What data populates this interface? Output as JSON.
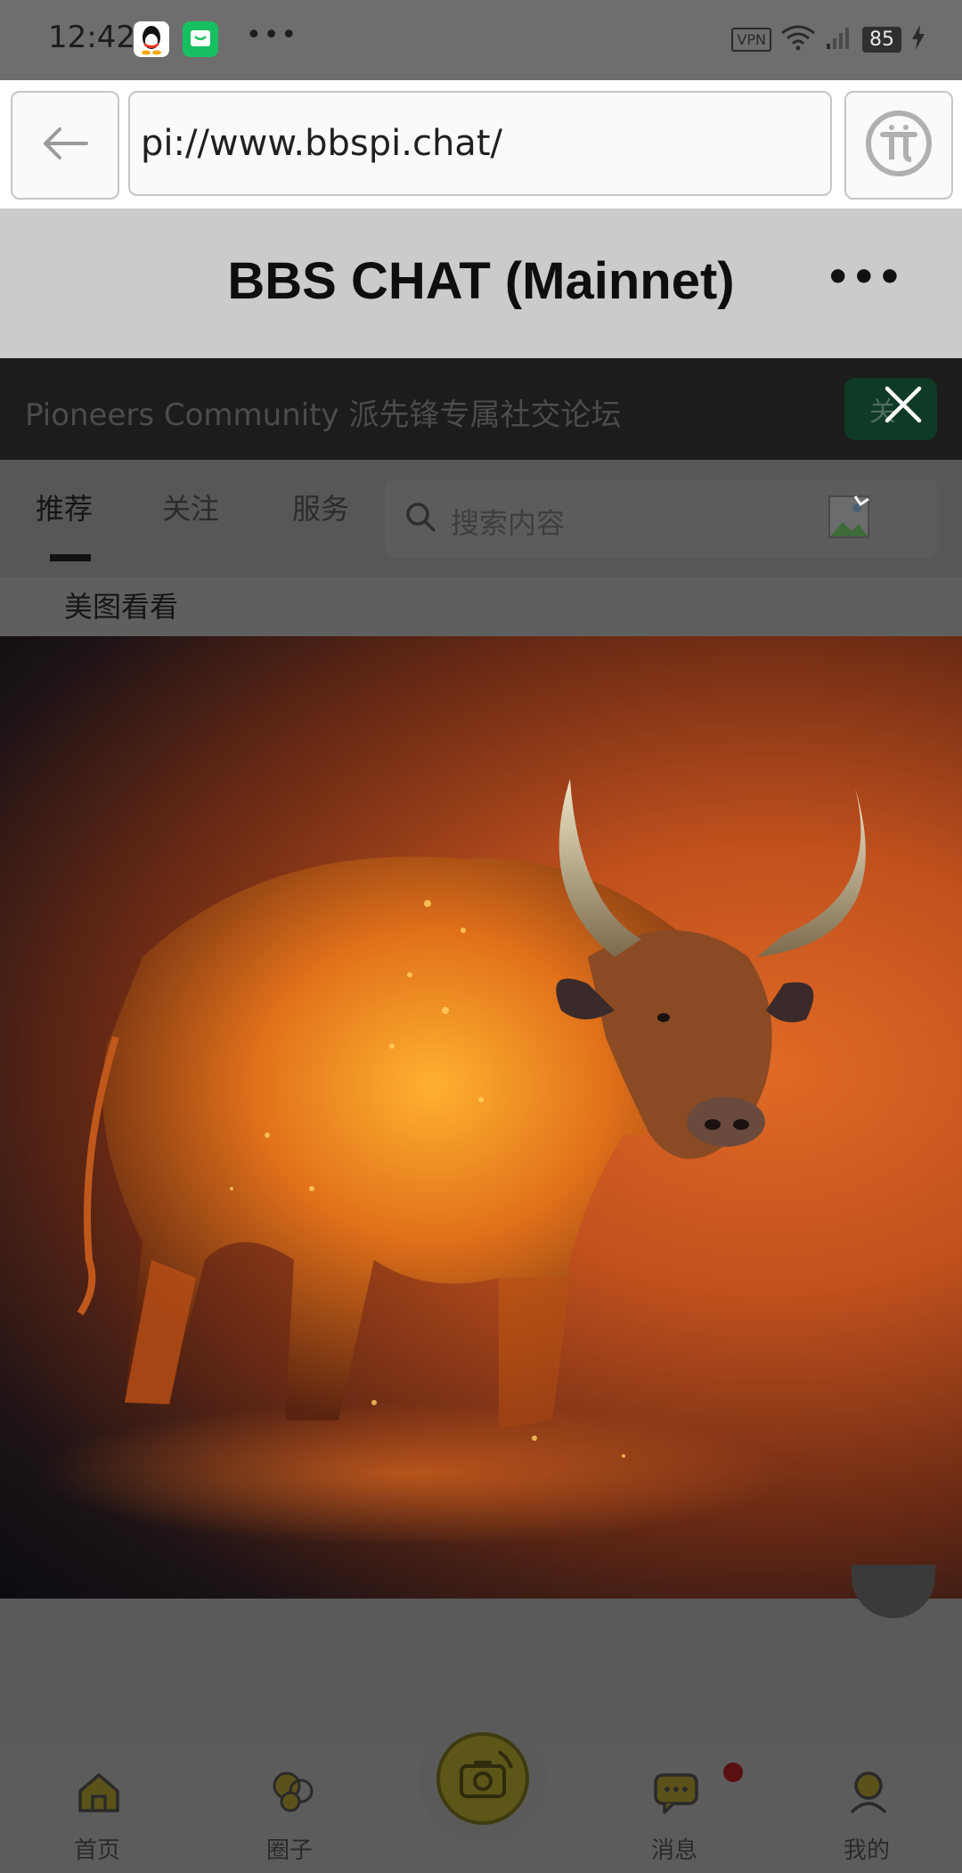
{
  "status_bar": {
    "time": "12:42",
    "dots": "•••",
    "vpn": "VPN",
    "battery": "85"
  },
  "browser": {
    "url": "pi://www.bbspi.chat/"
  },
  "app": {
    "title": "BBS CHAT (Mainnet)",
    "more": "•••"
  },
  "banner": {
    "text": "Pioneers Community 派先锋专属社交论坛",
    "button_label": "关"
  },
  "tabs": [
    {
      "label": "推荐"
    },
    {
      "label": "关注"
    },
    {
      "label": "服务"
    }
  ],
  "search": {
    "placeholder": "搜索内容"
  },
  "subtab": {
    "label": "美图看看"
  },
  "bottom_nav": [
    {
      "label": "首页"
    },
    {
      "label": "圈子"
    },
    {
      "label": "消息"
    },
    {
      "label": "我的"
    }
  ],
  "colors": {
    "accent_yellow": "#f5d000",
    "notification_red": "#e02020"
  }
}
